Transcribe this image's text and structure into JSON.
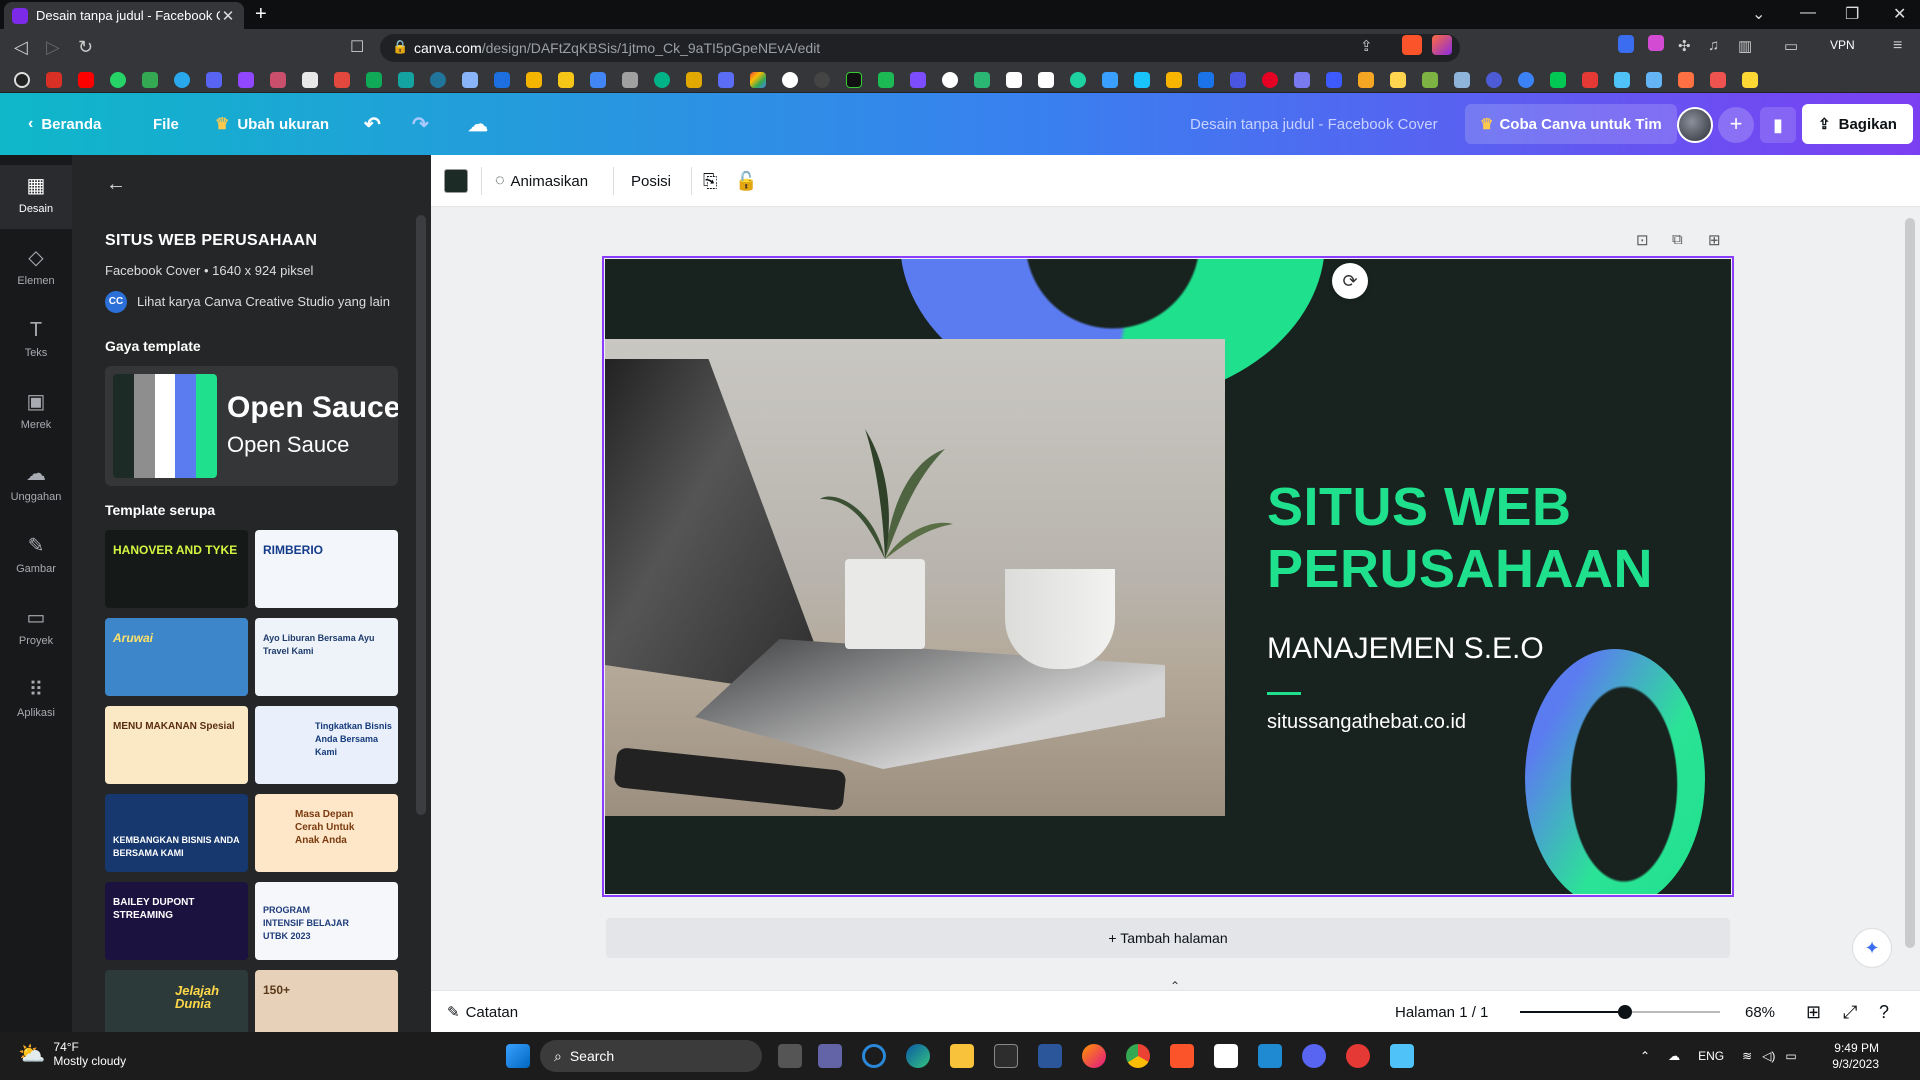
{
  "browser": {
    "tab_title": "Desain tanpa judul - Facebook Co",
    "url_host": "canva.com",
    "url_path": "/design/DAFtZqKBSis/1jtmo_Ck_9aTI5pGpeNEvA/edit",
    "vpn_label": "VPN"
  },
  "topbar": {
    "home": "Beranda",
    "file": "File",
    "resize": "Ubah ukuran",
    "doc_title": "Desain tanpa judul - Facebook Cover",
    "try_team": "Coba Canva untuk Tim",
    "share": "Bagikan"
  },
  "rail": [
    {
      "label": "Desain",
      "icon": "layout-icon"
    },
    {
      "label": "Elemen",
      "icon": "shapes-icon"
    },
    {
      "label": "Teks",
      "icon": "text-icon"
    },
    {
      "label": "Merek",
      "icon": "brand-icon"
    },
    {
      "label": "Unggahan",
      "icon": "upload-icon"
    },
    {
      "label": "Gambar",
      "icon": "draw-icon"
    },
    {
      "label": "Proyek",
      "icon": "folder-icon"
    },
    {
      "label": "Aplikasi",
      "icon": "apps-icon"
    }
  ],
  "panel": {
    "title": "SITUS WEB PERUSAHAAN",
    "subtitle": "Facebook Cover • 1640 x 924 piksel",
    "creator_badge": "CC",
    "creator_link": "Lihat karya Canva Creative Studio yang lain",
    "style_heading": "Gaya template",
    "font_heading_sample": "Open Sauce",
    "font_body_sample": "Open Sauce",
    "similar_heading": "Template serupa",
    "swatches": [
      "#1c2b25",
      "#8e8e8e",
      "#ffffff",
      "#5b7cf0",
      "#1fe08d"
    ],
    "thumbs": [
      {
        "text": "HANOVER AND TYKE",
        "bg": "#151a18",
        "fg": "#d4f542"
      },
      {
        "text": "RIMBERIO",
        "bg": "#f3f6fb",
        "fg": "#133b8a"
      },
      {
        "text": "Aruwai",
        "bg": "#3c86c9",
        "fg": "#ffe36a"
      },
      {
        "text": "Ayo Liburan Bersama Ayu Travel Kami",
        "bg": "#eef3fa",
        "fg": "#1f3c6b"
      },
      {
        "text": "MENU MAKANAN Spesial",
        "bg": "#fbe9c5",
        "fg": "#5a2d10"
      },
      {
        "text": "Tingkatkan Bisnis Anda Bersama Kami",
        "bg": "#e9f0fb",
        "fg": "#153a7a"
      },
      {
        "text": "KEMBANGKAN BISNIS ANDA BERSAMA KAMI",
        "bg": "#16386e",
        "fg": "#ffffff"
      },
      {
        "text": "Masa Depan Cerah Untuk Anak Anda",
        "bg": "#fde7c8",
        "fg": "#7a3b10"
      },
      {
        "text": "BAILEY DUPONT STREAMING",
        "bg": "#1b1240",
        "fg": "#ffffff"
      },
      {
        "text": "PROGRAM INTENSIF BELAJAR UTBK 2023",
        "bg": "#f6f7fb",
        "fg": "#1f3c7a"
      },
      {
        "text": "Jelajah Dunia",
        "bg": "#2d3a3a",
        "fg": "#ffd84a"
      },
      {
        "text": "150+",
        "bg": "#e7d2b9",
        "fg": "#5a3a1a"
      }
    ]
  },
  "context_bar": {
    "color": "#1c2b25",
    "animate": "Animasikan",
    "position": "Posisi"
  },
  "design": {
    "headline": "SITUS WEB PERUSAHAAN",
    "subheadline": "MANAJEMEN S.E.O",
    "website": "situssangathebat.co.id",
    "bg_color": "#18231f",
    "accent": "#1fe08d",
    "accent2": "#5b7cf0"
  },
  "add_page": "+ Tambah halaman",
  "footer": {
    "notes": "Catatan",
    "page_label": "Halaman 1 / 1",
    "zoom_value": 68,
    "zoom_label": "68%"
  },
  "taskbar": {
    "temp": "74°F",
    "weather": "Mostly cloudy",
    "search": "Search",
    "lang": "ENG",
    "time": "9:49 PM",
    "date": "9/3/2023"
  }
}
